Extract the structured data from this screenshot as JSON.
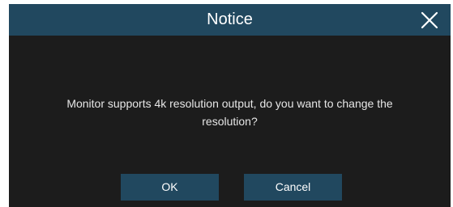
{
  "dialog": {
    "title": "Notice",
    "close_icon": "close-icon",
    "message_line1": "Monitor supports 4k resolution output, do you want to change the",
    "message_line2": "resolution?",
    "ok_label": "OK",
    "cancel_label": "Cancel"
  },
  "colors": {
    "titlebar": "#21485f",
    "body": "#1c1c1c",
    "button": "#21485f",
    "text": "#ffffff"
  }
}
